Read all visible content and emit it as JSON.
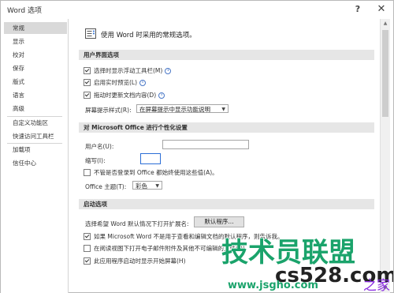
{
  "window": {
    "title": "Word 选项",
    "help_label": "?",
    "close_label": "✕"
  },
  "sidebar": {
    "items": [
      {
        "label": "常规"
      },
      {
        "label": "显示"
      },
      {
        "label": "校对"
      },
      {
        "label": "保存"
      },
      {
        "label": "版式"
      },
      {
        "label": "语言"
      },
      {
        "label": "高级"
      },
      {
        "label": "自定义功能区"
      },
      {
        "label": "快速访问工具栏"
      },
      {
        "label": "加载项"
      },
      {
        "label": "信任中心"
      }
    ]
  },
  "main": {
    "intro": "使用 Word 时采用的常规选项。",
    "ui_section": {
      "header": "用户界面选项",
      "options": [
        {
          "label": "选择时显示浮动工具栏(M)",
          "checked": true
        },
        {
          "label": "启用实时预览(L)",
          "checked": true
        },
        {
          "label": "拖动时更新文档内容(D)",
          "checked": true
        }
      ],
      "screentip_label": "屏幕提示样式(R):",
      "screentip_value": "在屏幕提示中显示功能说明"
    },
    "personal_section": {
      "header": "对 Microsoft Office 进行个性化设置",
      "username_label": "用户名(U):",
      "username_value": "",
      "initials_label": "缩写(I):",
      "initials_value": "",
      "always_use_label": "不管是否登录到 Office 都始终使用这些值(A)。",
      "always_use_checked": false,
      "theme_label": "Office 主题(T):",
      "theme_value": "彩色"
    },
    "startup_section": {
      "header": "启动选项",
      "default_ext_label": "选择希望 Word 默认情况下打开扩展名:",
      "default_programs_button": "默认程序...",
      "options": [
        {
          "label": "如果 Microsoft Word 不是用于查看和编辑文档的默认程序，则告诉我。",
          "checked": true
        },
        {
          "label": "在阅读视图下打开电子邮件附件及其他不可编辑的文件(O)",
          "checked": false
        },
        {
          "label": "此应用程序启动时显示开始屏幕(H)",
          "checked": true
        }
      ]
    }
  },
  "watermark": {
    "brand_text": "技术员联盟",
    "site_text": "cs528.com",
    "url_text": "www.jsgho.com",
    "home_text": "之家",
    "colors": {
      "green": "#1aa36b",
      "dark": "#222222",
      "purple": "#8a2be2"
    }
  },
  "icons": {
    "intro": "options-general-icon",
    "info": "info-icon",
    "dropdown": "chevron-down-icon",
    "help": "help-icon",
    "close": "close-icon"
  }
}
